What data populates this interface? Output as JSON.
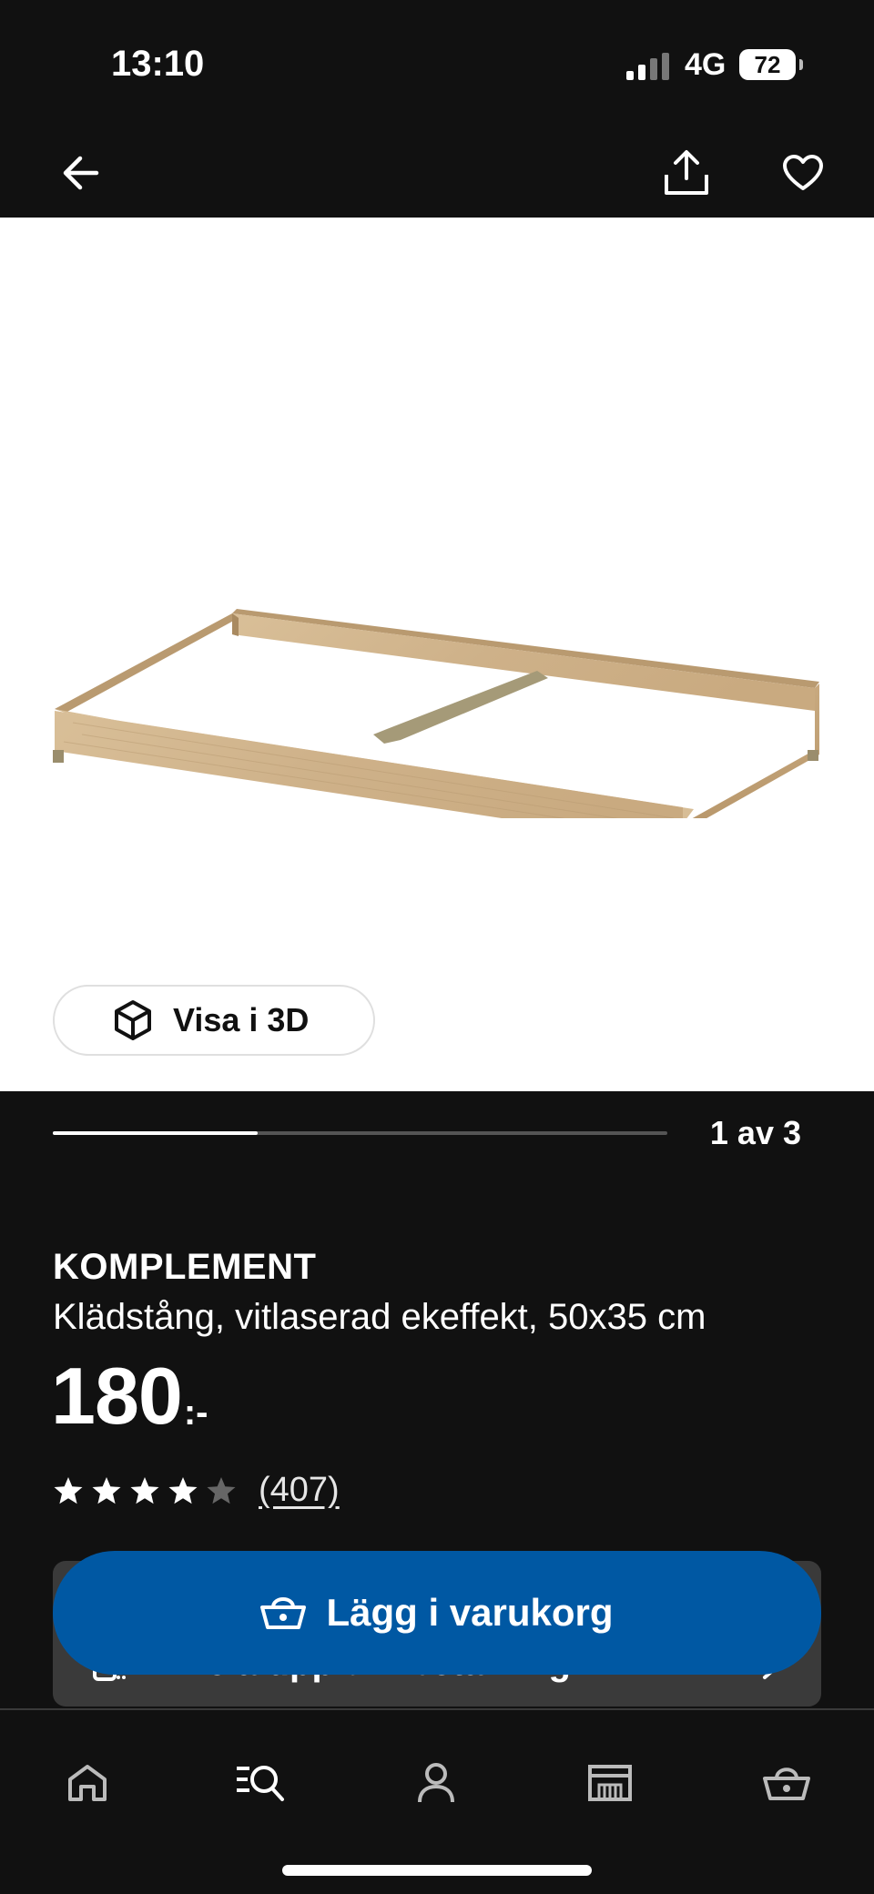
{
  "status_bar": {
    "time": "13:10",
    "network": "4G",
    "battery": "72"
  },
  "top_bar": {
    "back_icon": "arrow-left-icon",
    "share_icon": "share-icon",
    "favorite_icon": "heart-icon"
  },
  "gallery": {
    "view_3d_label": "Visa i 3D",
    "page_counter": "1 av 3",
    "progress": 0.333
  },
  "product": {
    "brand": "KOMPLEMENT",
    "description": "Klädstång, vitlaserad ekeffekt, 50x35 cm",
    "price": "180",
    "price_suffix": ":-",
    "rating": 4,
    "rating_max": 5,
    "review_count": "(407)"
  },
  "installment": {
    "label": "Dela upp din betalning"
  },
  "cta": {
    "label": "Lägg i varukorg",
    "icon": "basket-icon"
  },
  "bottom_nav": {
    "items": [
      {
        "icon": "home-icon"
      },
      {
        "icon": "search-icon"
      },
      {
        "icon": "profile-icon"
      },
      {
        "icon": "store-icon"
      },
      {
        "icon": "basket-icon"
      }
    ]
  },
  "colors": {
    "background": "#111111",
    "accent": "#0058a3",
    "gallery_bg": "#ffffff"
  }
}
